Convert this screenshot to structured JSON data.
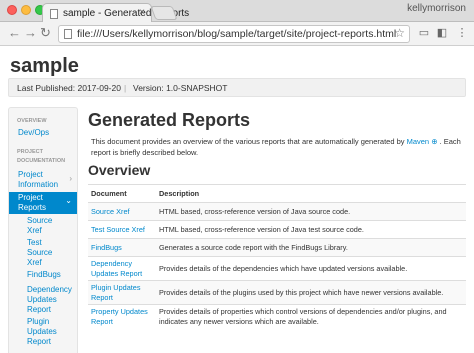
{
  "browser": {
    "tab_title": "sample - Generated Reports",
    "tab_close": "×",
    "profile_name": "kellymorrison",
    "url": "file:///Users/kellymorrison/blog/sample/target/site/project-reports.html"
  },
  "site": {
    "title": "sample",
    "last_published": "Last Published: 2017-09-20",
    "separator": "|",
    "version": "Version: 1.0-SNAPSHOT"
  },
  "sidebar": {
    "overview_header": "OVERVIEW",
    "devops": "Dev/Ops",
    "project_doc_header_1": "PROJECT",
    "project_doc_header_2": "DOCUMENTATION",
    "project_information_1": "Project",
    "project_information_2": "Information",
    "project_reports_1": "Project",
    "project_reports_2": "Reports",
    "items": [
      {
        "l1": "Source",
        "l2": "Xref"
      },
      {
        "l1": "Test",
        "l2": "Source",
        "l3": "Xref"
      },
      {
        "l1": "FindBugs"
      },
      {
        "l1": "Dependency",
        "l2": "Updates",
        "l3": "Report"
      },
      {
        "l1": "Plugin",
        "l2": "Updates",
        "l3": "Report"
      }
    ]
  },
  "main": {
    "heading": "Generated Reports",
    "intro_before": "This document provides an overview of the various reports that are automatically generated by ",
    "intro_link": "Maven",
    "intro_after": " . Each report is briefly described below.",
    "overview_heading": "Overview",
    "table_headers": [
      "Document",
      "Description"
    ],
    "rows": [
      {
        "doc": "Source Xref",
        "desc": "HTML based, cross-reference version of Java source code."
      },
      {
        "doc": "Test Source Xref",
        "desc": "HTML based, cross-reference version of Java test source code."
      },
      {
        "doc": "FindBugs",
        "desc": "Generates a source code report with the FindBugs Library."
      },
      {
        "doc": "Dependency Updates Report",
        "desc": "Provides details of the dependencies which have updated versions available."
      },
      {
        "doc": "Plugin Updates Report",
        "desc": "Provides details of the plugins used by this project which have newer versions available."
      },
      {
        "doc": "Property Updates Report",
        "desc": "Provides details of properties which control versions of dependencies and/or plugins, and indicates any newer versions which are available."
      }
    ]
  },
  "icons": {
    "back": "back-arrow-icon",
    "forward": "forward-arrow-icon",
    "reload": "reload-icon",
    "star": "bookmark-star-icon",
    "cast": "cast-icon",
    "extension": "extension-icon",
    "menu": "menu-icon"
  },
  "colors": {
    "link": "#0088cc",
    "active_nav": "#0088cc"
  }
}
